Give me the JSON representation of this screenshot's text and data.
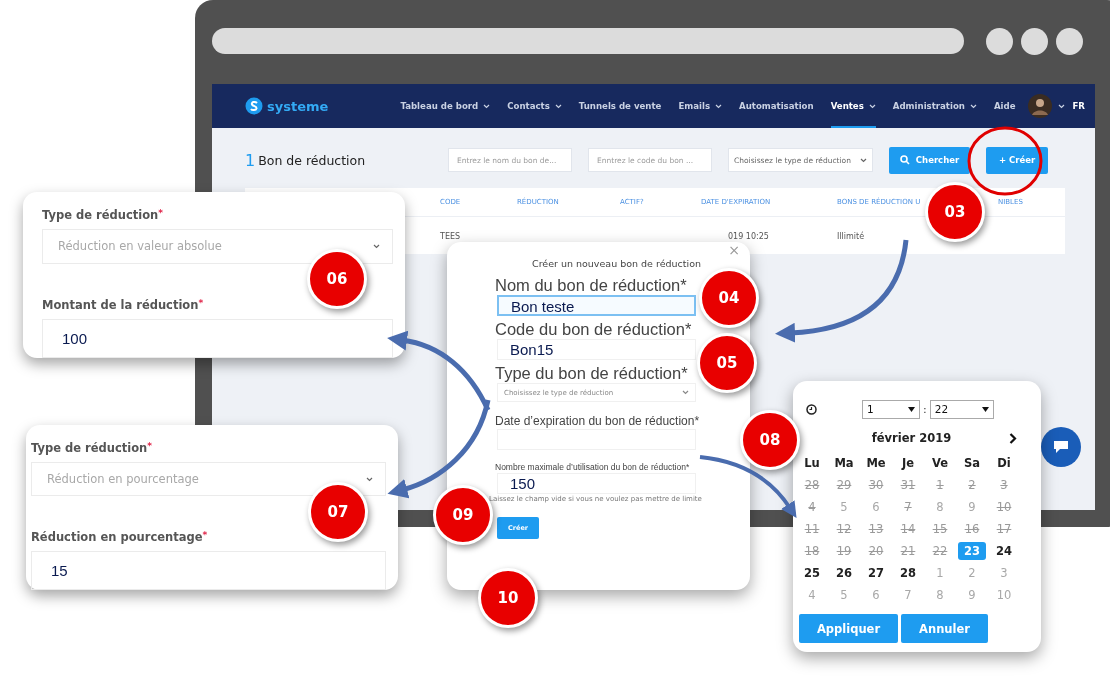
{
  "nav": {
    "logo": "systeme",
    "items": [
      {
        "label": "Tableau de bord",
        "dropdown": true,
        "selected": false
      },
      {
        "label": "Contacts",
        "dropdown": true,
        "selected": false
      },
      {
        "label": "Tunnels de vente",
        "dropdown": false,
        "selected": false
      },
      {
        "label": "Emails",
        "dropdown": true,
        "selected": false
      },
      {
        "label": "Automatisation",
        "dropdown": false,
        "selected": false
      },
      {
        "label": "Ventes",
        "dropdown": true,
        "selected": true
      },
      {
        "label": "Administration",
        "dropdown": true,
        "selected": false
      },
      {
        "label": "Aide",
        "dropdown": false,
        "selected": false
      }
    ],
    "language": "FR"
  },
  "page": {
    "count": "1",
    "title": "Bon de réduction",
    "filters": [
      {
        "kind": "input",
        "placeholder": "Entrez le nom du bon de..."
      },
      {
        "kind": "input",
        "placeholder": "Enntrez le code du bon ..."
      },
      {
        "kind": "select",
        "placeholder": "Choisissez le type de réduction"
      }
    ],
    "buttons": [
      {
        "kind": "search",
        "label": "Chercher"
      },
      {
        "kind": "add",
        "label": "+ Créer"
      }
    ]
  },
  "table": {
    "columns": [
      "CODE",
      "RÉDUCTION",
      "ACTIF?",
      "DATE D'EXPIRATION",
      "BONS DE RÉDUCTION U",
      "NIBLES"
    ],
    "rows": [
      {
        "code": "TEES",
        "expiration": "019 10:25",
        "limit": "Illimité"
      }
    ]
  },
  "cards": [
    {
      "fields": [
        {
          "kind": "select",
          "label": "Type de réduction",
          "required_mark": "*",
          "value": "Réduction en valeur absolue"
        },
        {
          "kind": "input",
          "label": "Montant de la réduction",
          "required_mark": "*",
          "value": "100"
        }
      ]
    },
    {
      "fields": [
        {
          "kind": "select",
          "label": "Type de réduction",
          "required_mark": "*",
          "value": "Réduction en pourcentage"
        },
        {
          "kind": "input",
          "label": "Réduction en pourcentage",
          "required_mark": "*",
          "value": "15"
        }
      ]
    }
  ],
  "modal": {
    "title": "Créer un nouveau bon de réduction",
    "close": "×",
    "fields": [
      {
        "kind": "input",
        "label": "Nom du bon de réduction*",
        "value": "Bon teste",
        "focused": true,
        "emphasized": true
      },
      {
        "kind": "input",
        "label": "Code du bon de réduction*",
        "value": "Bon15",
        "focused": false,
        "emphasized": true
      },
      {
        "kind": "select",
        "label": "Type du bon de réduction*",
        "placeholder": "Choisissez le type de réduction",
        "focused": false,
        "emphasized": true
      },
      {
        "kind": "input",
        "label": "Date d’expiration du bon de réduction*",
        "focused": false,
        "emphasized": false
      },
      {
        "kind": "input",
        "label": "Nombre maximale d’utilisation du bon de réduction*",
        "value": "150",
        "hint": "Laissez le champ vide si vous ne voulez pas mettre de limite",
        "focused": false,
        "emphasized": false
      }
    ],
    "submit": "Créer"
  },
  "calendar": {
    "hour": "1",
    "separator": ":",
    "minute": "22",
    "month": "février 2019",
    "weekdays": [
      "Lu",
      "Ma",
      "Me",
      "Je",
      "Ve",
      "Sa",
      "Di"
    ],
    "weeks": [
      [
        {
          "day": "28",
          "kind": "disabled",
          "selected": false
        },
        {
          "day": "29",
          "kind": "disabled",
          "selected": false
        },
        {
          "day": "30",
          "kind": "disabled",
          "selected": false
        },
        {
          "day": "31",
          "kind": "disabled",
          "selected": false
        },
        {
          "day": "1",
          "kind": "disabled",
          "selected": false
        },
        {
          "day": "2",
          "kind": "disabled",
          "selected": false
        },
        {
          "day": "3",
          "kind": "disabled",
          "selected": false
        }
      ],
      [
        {
          "day": "4",
          "kind": "disabled",
          "selected": false
        },
        {
          "day": "5",
          "kind": "muted",
          "selected": false
        },
        {
          "day": "6",
          "kind": "muted",
          "selected": false
        },
        {
          "day": "7",
          "kind": "disabled",
          "selected": false
        },
        {
          "day": "8",
          "kind": "muted",
          "selected": false
        },
        {
          "day": "9",
          "kind": "muted",
          "selected": false
        },
        {
          "day": "10",
          "kind": "disabled",
          "selected": false
        }
      ],
      [
        {
          "day": "11",
          "kind": "disabled",
          "selected": false
        },
        {
          "day": "12",
          "kind": "disabled",
          "selected": false
        },
        {
          "day": "13",
          "kind": "disabled",
          "selected": false
        },
        {
          "day": "14",
          "kind": "disabled",
          "selected": false
        },
        {
          "day": "15",
          "kind": "disabled",
          "selected": false
        },
        {
          "day": "16",
          "kind": "disabled",
          "selected": false
        },
        {
          "day": "17",
          "kind": "disabled",
          "selected": false
        }
      ],
      [
        {
          "day": "18",
          "kind": "disabled",
          "selected": false
        },
        {
          "day": "19",
          "kind": "disabled",
          "selected": false
        },
        {
          "day": "20",
          "kind": "disabled",
          "selected": false
        },
        {
          "day": "21",
          "kind": "disabled",
          "selected": false
        },
        {
          "day": "22",
          "kind": "disabled",
          "selected": false
        },
        {
          "day": "23",
          "kind": "normal",
          "selected": true
        },
        {
          "day": "24",
          "kind": "normal",
          "selected": false
        }
      ],
      [
        {
          "day": "25",
          "kind": "normal",
          "selected": false
        },
        {
          "day": "26",
          "kind": "normal",
          "selected": false
        },
        {
          "day": "27",
          "kind": "normal",
          "selected": false
        },
        {
          "day": "28",
          "kind": "normal",
          "selected": false
        },
        {
          "day": "1",
          "kind": "muted",
          "selected": false
        },
        {
          "day": "2",
          "kind": "muted",
          "selected": false
        },
        {
          "day": "3",
          "kind": "muted",
          "selected": false
        }
      ],
      [
        {
          "day": "4",
          "kind": "muted",
          "selected": false
        },
        {
          "day": "5",
          "kind": "muted",
          "selected": false
        },
        {
          "day": "6",
          "kind": "muted",
          "selected": false
        },
        {
          "day": "7",
          "kind": "muted",
          "selected": false
        },
        {
          "day": "8",
          "kind": "muted",
          "selected": false
        },
        {
          "day": "9",
          "kind": "muted",
          "selected": false
        },
        {
          "day": "10",
          "kind": "muted",
          "selected": false
        }
      ]
    ],
    "buttons": [
      "Appliquer",
      "Annuler"
    ]
  },
  "steps": [
    "03",
    "04",
    "05",
    "06",
    "07",
    "08",
    "09",
    "10"
  ]
}
